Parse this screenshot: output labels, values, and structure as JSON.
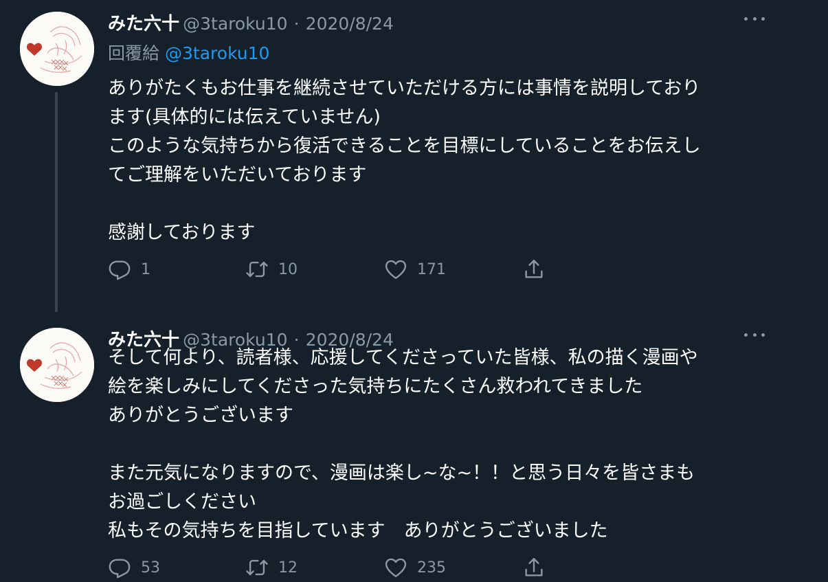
{
  "tweets": [
    {
      "author": {
        "name": "みた六十",
        "handle": "@3taroku10"
      },
      "separator": "·",
      "date": "2020/8/24",
      "reply_to": {
        "label": "回覆給",
        "handle": "@3taroku10"
      },
      "paragraphs": [
        [
          "ありがたくもお仕事を継続させていただける方には事情を説明しており",
          "ます(具体的には伝えていません)",
          "このような気持ちから復活できることを目標にしていることをお伝えし",
          "てご理解をいただいております"
        ],
        [
          "感謝しております"
        ]
      ],
      "actions": {
        "replies": "1",
        "retweets": "10",
        "likes": "171"
      }
    },
    {
      "author": {
        "name": "みた六十",
        "handle": "@3taroku10"
      },
      "separator": "·",
      "date": "2020/8/24",
      "paragraphs": [
        [
          "そして何より、読者様、応援してくださっていた皆様、私の描く漫画や",
          "絵を楽しみにしてくださった気持ちにたくさん救われてきました",
          "ありがとうございます"
        ],
        [
          "また元気になりますので、漫画は楽し~な~！！と思う日々を皆さまも",
          "お過ごしください",
          "私もその気持ちを目指しています　ありがとうございました"
        ]
      ],
      "actions": {
        "replies": "53",
        "retweets": "12",
        "likes": "235"
      }
    }
  ],
  "icons": {
    "reply": "reply-icon",
    "retweet": "retweet-icon",
    "like": "heart-icon",
    "share": "share-icon",
    "more": "more-icon",
    "avatar": "avatar-illustration"
  },
  "colors": {
    "background": "#15202b",
    "text": "#ffffff",
    "muted": "#8b98a5",
    "link": "#1d9bf0",
    "thread_line": "#38444d",
    "avatar_heart": "#c0392b"
  }
}
